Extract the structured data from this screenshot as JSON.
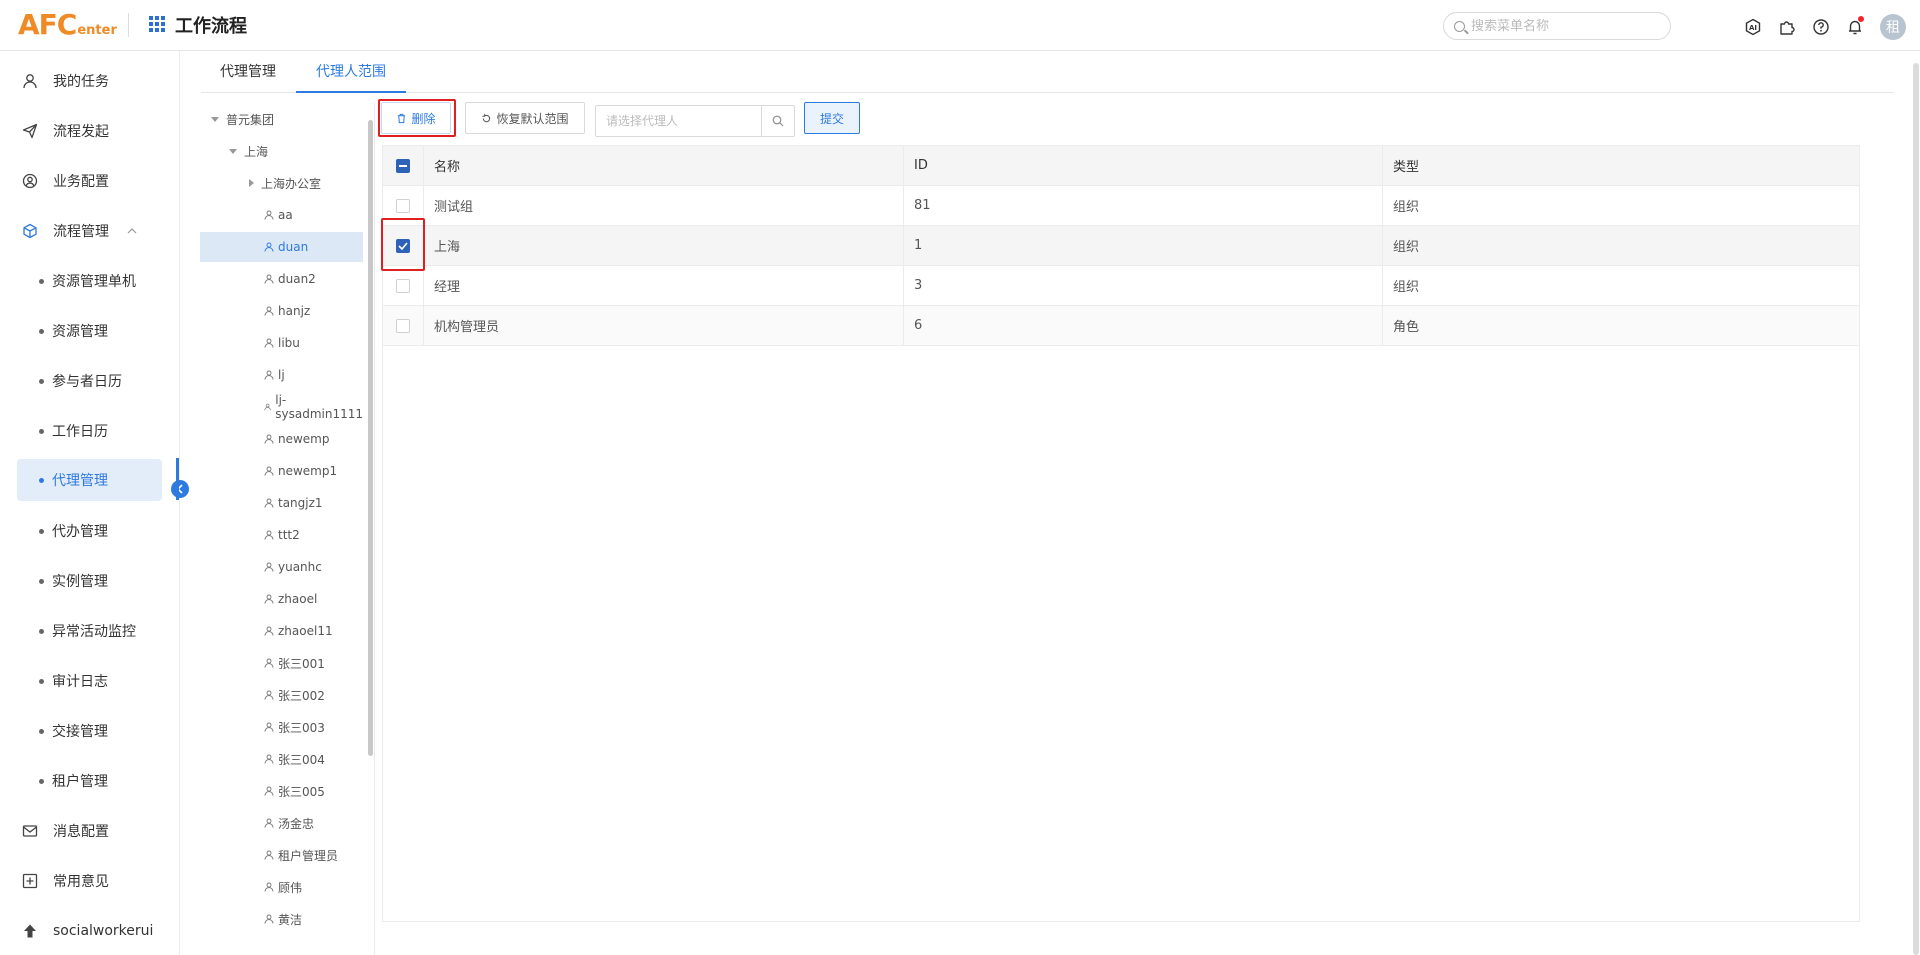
{
  "header": {
    "logo_main": "AFC",
    "logo_sub": "enter",
    "app_title": "工作流程",
    "search_placeholder": "搜索菜单名称",
    "avatar_text": "租",
    "icons": [
      "ai-icon",
      "puzzle-icon",
      "help-icon",
      "bell-icon"
    ]
  },
  "sidebar": {
    "items": [
      {
        "label": "我的任务",
        "icon": "user-icon"
      },
      {
        "label": "流程发起",
        "icon": "send-icon"
      },
      {
        "label": "业务配置",
        "icon": "settings-user-icon"
      },
      {
        "label": "流程管理",
        "icon": "cube-icon",
        "expanded": true
      },
      {
        "label": "资源管理单机"
      },
      {
        "label": "资源管理"
      },
      {
        "label": "参与者日历"
      },
      {
        "label": "工作日历"
      },
      {
        "label": "代理管理",
        "active": true
      },
      {
        "label": "代办管理"
      },
      {
        "label": "实例管理"
      },
      {
        "label": "异常活动监控"
      },
      {
        "label": "审计日志"
      },
      {
        "label": "交接管理"
      },
      {
        "label": "租户管理"
      },
      {
        "label": "消息配置",
        "icon": "mail-icon"
      },
      {
        "label": "常用意见",
        "icon": "comment-add-icon"
      },
      {
        "label": "socialworkerui",
        "icon": "upload-icon"
      }
    ]
  },
  "tabs": [
    {
      "label": "代理管理",
      "active": false
    },
    {
      "label": "代理人范围",
      "active": true
    }
  ],
  "tree": {
    "root": "普元集团",
    "level1": "上海",
    "level2": "上海办公室",
    "users": [
      "aa",
      "duan",
      "duan2",
      "hanjz",
      "libu",
      "lj",
      "lj-sysadmin1111",
      "newemp",
      "newemp1",
      "tangjz1",
      "ttt2",
      "yuanhc",
      "zhaoel",
      "zhaoel11",
      "张三001",
      "张三002",
      "张三003",
      "张三004",
      "张三005",
      "汤金忠",
      "租户管理员",
      "顾伟",
      "黄洁"
    ],
    "selected": "duan"
  },
  "toolbar": {
    "delete_label": "删除",
    "restore_label": "恢复默认范围",
    "agent_placeholder": "请选择代理人",
    "submit_label": "提交"
  },
  "table": {
    "headers": [
      "名称",
      "ID",
      "类型"
    ],
    "rows": [
      {
        "name": "测试组",
        "id": "81",
        "type": "组织",
        "checked": false
      },
      {
        "name": "上海",
        "id": "1",
        "type": "组织",
        "checked": true
      },
      {
        "name": "经理",
        "id": "3",
        "type": "组织",
        "checked": false
      },
      {
        "name": "机构管理员",
        "id": "6",
        "type": "角色",
        "checked": false
      }
    ]
  },
  "colors": {
    "accent": "#2d7be0",
    "logo": "#f08a24",
    "highlight_frame": "#e02020"
  }
}
